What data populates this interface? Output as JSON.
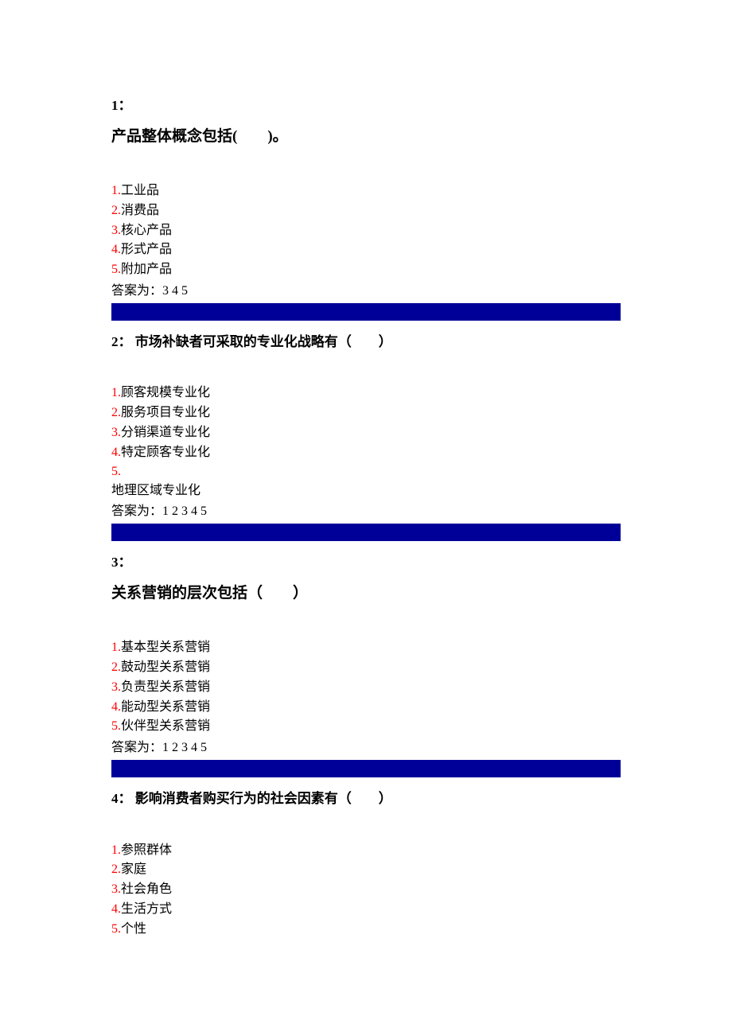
{
  "q1": {
    "number": "1：",
    "text": "产品整体概念包括(　　)。",
    "options": [
      {
        "num": "1.",
        "text": "工业品"
      },
      {
        "num": "2.",
        "text": "消费品"
      },
      {
        "num": "3.",
        "text": "核心产品"
      },
      {
        "num": "4.",
        "text": "形式产品"
      },
      {
        "num": "5.",
        "text": "附加产品"
      }
    ],
    "answer": "答案为：3 4 5"
  },
  "q2": {
    "number": "2：",
    "text": "市场补缺者可采取的专业化战略有（　　）",
    "options": [
      {
        "num": "1.",
        "text": "顾客规模专业化"
      },
      {
        "num": "2.",
        "text": "服务项目专业化"
      },
      {
        "num": "3.",
        "text": "分销渠道专业化"
      },
      {
        "num": "4.",
        "text": "特定顾客专业化"
      },
      {
        "num": "5.",
        "text": ""
      }
    ],
    "overflow": "地理区域专业化",
    "answer": "答案为：1 2 3 4 5"
  },
  "q3": {
    "number": "3：",
    "text": "关系营销的层次包括（　　）",
    "options": [
      {
        "num": "1.",
        "text": "基本型关系营销"
      },
      {
        "num": "2.",
        "text": "鼓动型关系营销"
      },
      {
        "num": "3.",
        "text": "负责型关系营销"
      },
      {
        "num": "4.",
        "text": "能动型关系营销"
      },
      {
        "num": "5.",
        "text": "伙伴型关系营销"
      }
    ],
    "answer": "答案为：1 2 3 4 5"
  },
  "q4": {
    "number": "4：",
    "text": "影响消费者购买行为的社会因素有（　　）",
    "options": [
      {
        "num": "1.",
        "text": "参照群体"
      },
      {
        "num": "2.",
        "text": "家庭"
      },
      {
        "num": "3.",
        "text": "社会角色"
      },
      {
        "num": "4.",
        "text": "生活方式"
      },
      {
        "num": "5.",
        "text": "个性"
      }
    ]
  }
}
